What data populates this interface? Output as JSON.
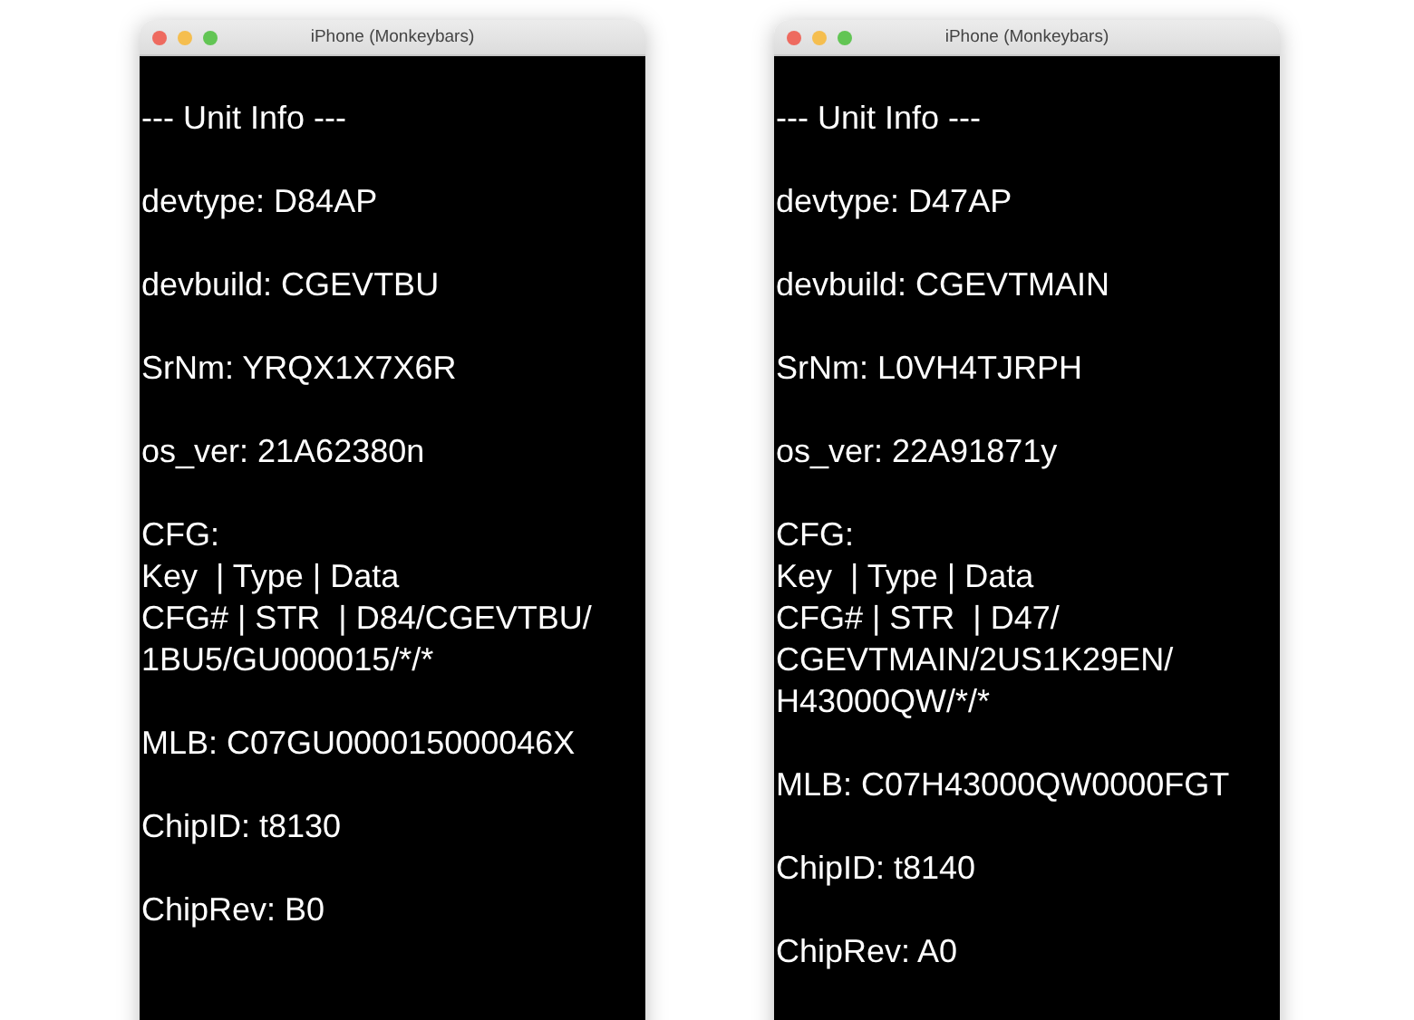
{
  "windows": [
    {
      "title": "iPhone (Monkeybars)",
      "blocks": [
        [
          "--- Unit Info ---"
        ],
        [
          "devtype: D84AP"
        ],
        [
          "devbuild: CGEVTBU"
        ],
        [
          "SrNm: YRQX1X7X6R"
        ],
        [
          "os_ver: 21A62380n"
        ],
        [
          "CFG:",
          "Key  | Type | Data",
          "CFG# | STR  | D84/CGEVTBU/",
          "1BU5/GU000015/*/*"
        ],
        [
          "MLB: C07GU000015000046X"
        ],
        [
          "ChipID: t8130"
        ],
        [
          "ChipRev: B0"
        ]
      ]
    },
    {
      "title": "iPhone (Monkeybars)",
      "blocks": [
        [
          "--- Unit Info ---"
        ],
        [
          "devtype: D47AP"
        ],
        [
          "devbuild: CGEVTMAIN"
        ],
        [
          "SrNm: L0VH4TJRPH"
        ],
        [
          "os_ver: 22A91871y"
        ],
        [
          "CFG:",
          "Key  | Type | Data",
          "CFG# | STR  | D47/",
          "CGEVTMAIN/2US1K29EN/",
          "H43000QW/*/*"
        ],
        [
          "MLB: C07H43000QW0000FGT"
        ],
        [
          "ChipID: t8140"
        ],
        [
          "ChipRev: A0"
        ]
      ]
    }
  ]
}
